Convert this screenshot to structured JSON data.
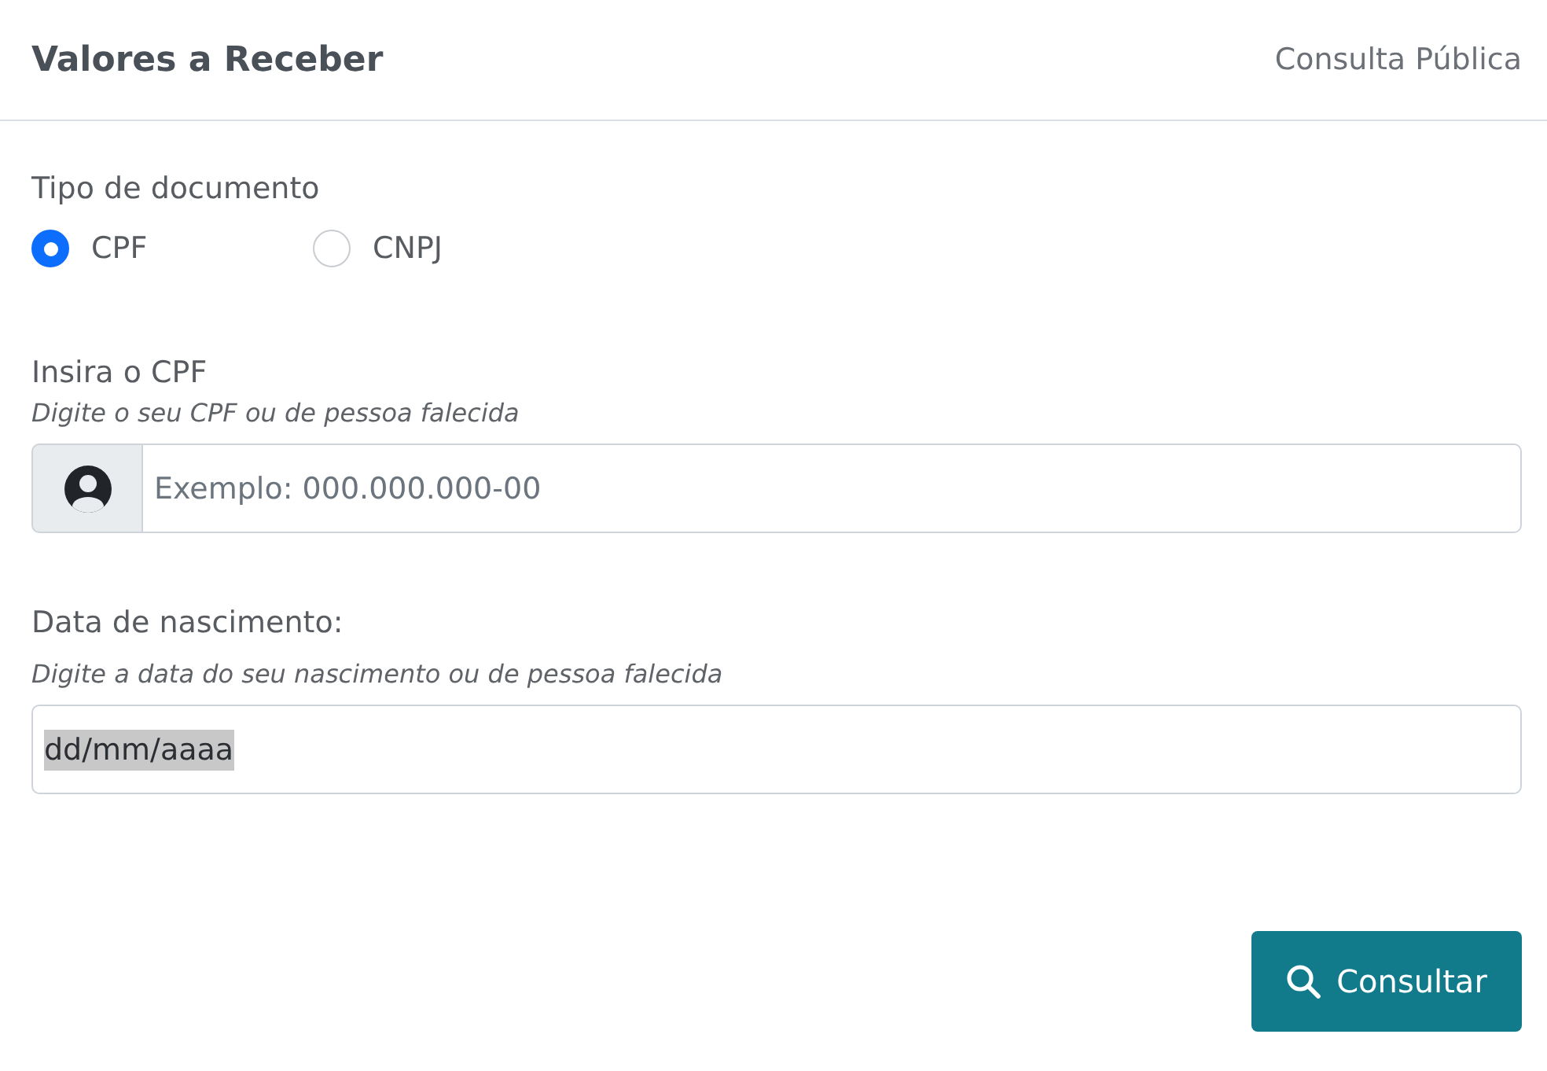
{
  "header": {
    "title": "Valores a Receber",
    "link": "Consulta Pública"
  },
  "document_type": {
    "label": "Tipo de documento",
    "options": [
      {
        "label": "CPF",
        "selected": true
      },
      {
        "label": "CNPJ",
        "selected": false
      }
    ]
  },
  "fields": [
    {
      "kind": "addon",
      "label": "Insira o CPF",
      "hint": "Digite o seu CPF ou de pessoa falecida",
      "placeholder": "Exemplo: 000.000.000-00"
    },
    {
      "kind": "date",
      "label": "Data de nascimento:",
      "hint": "Digite a data do seu nascimento ou de pessoa falecida",
      "value": "dd/mm/aaaa",
      "text_selected": true
    }
  ],
  "submit_button": {
    "label": "Consultar"
  }
}
